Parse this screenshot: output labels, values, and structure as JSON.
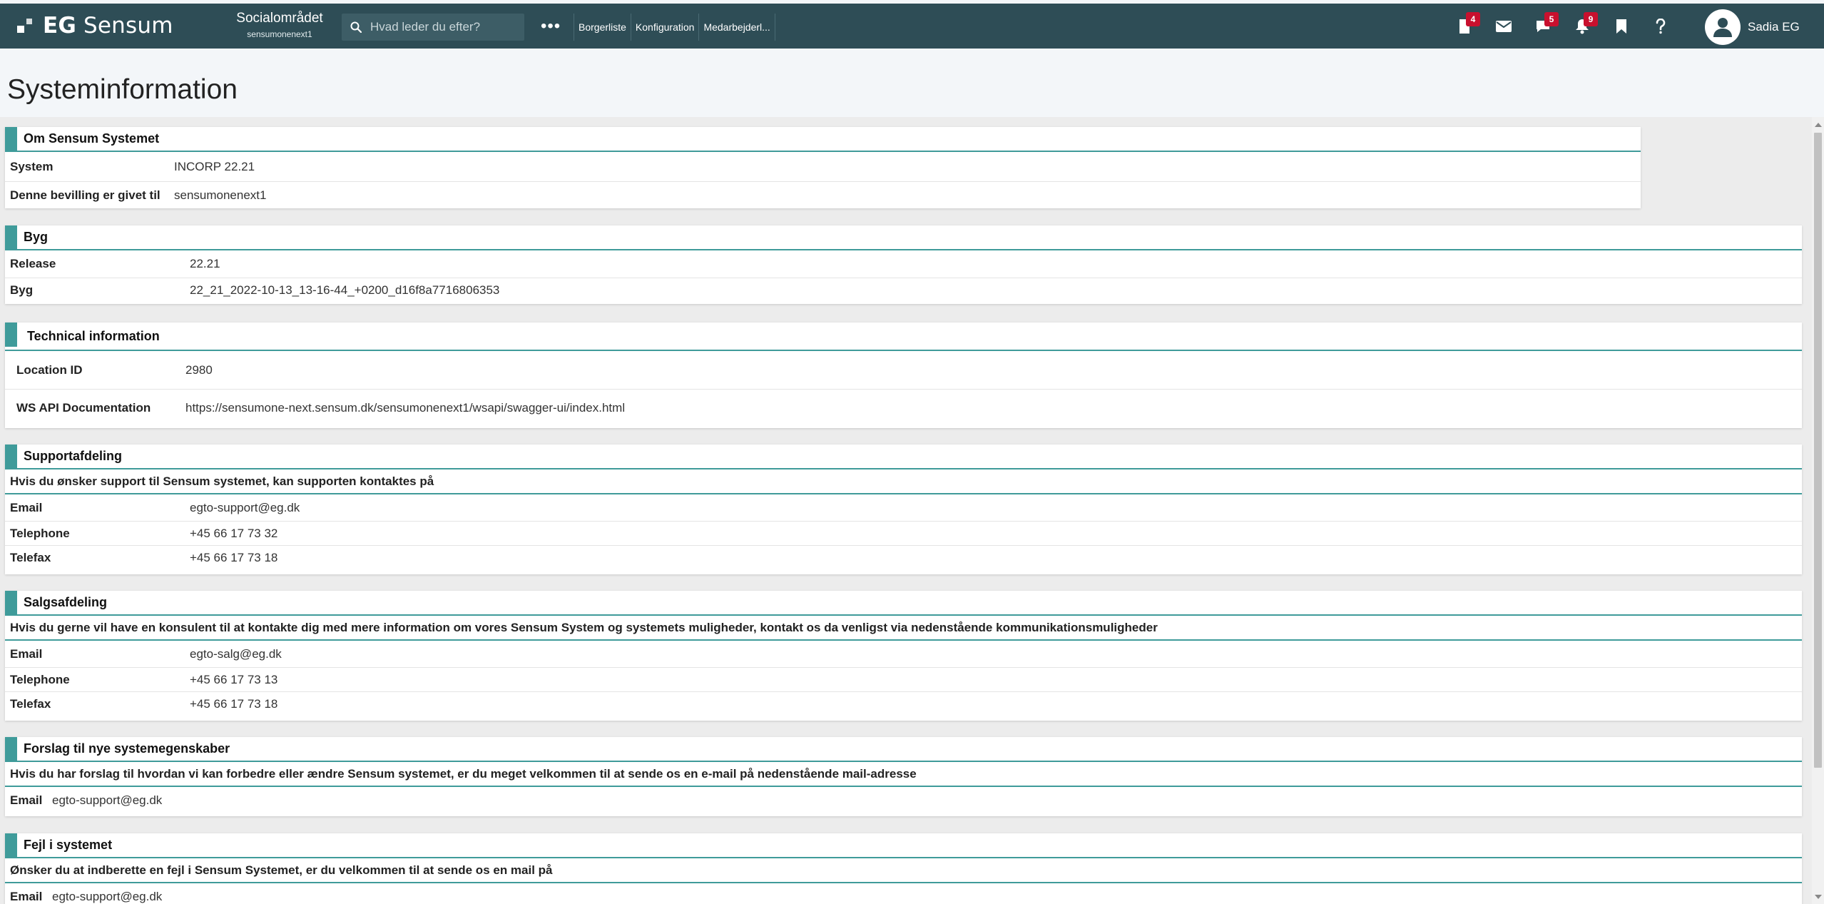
{
  "header": {
    "brand_bold": "EG",
    "brand_name": "Sensum",
    "area_title": "Socialområdet",
    "area_sub": "sensumonenext1",
    "search_placeholder": "Hvad leder du efter?",
    "more_label": "•••",
    "nav": [
      "Borgerliste",
      "Konfiguration",
      "Medarbejderl..."
    ],
    "badges": {
      "tasks": "4",
      "messages": "5",
      "notifications": "9"
    },
    "user_name": "Sadia EG"
  },
  "page": {
    "title": "Systeminformation"
  },
  "sections": {
    "about": {
      "title": "Om Sensum Systemet",
      "rows": [
        {
          "label": "System",
          "value": "INCORP 22.21"
        },
        {
          "label": "Denne bevilling er givet til",
          "value": "sensumonenext1"
        }
      ]
    },
    "build": {
      "title": "Byg",
      "rows": [
        {
          "label": "Release",
          "value": "22.21"
        },
        {
          "label": "Byg",
          "value": "22_21_2022-10-13_13-16-44_+0200_d16f8a7716806353"
        }
      ]
    },
    "tech": {
      "title": "Technical information",
      "rows": [
        {
          "label": "Location ID",
          "value": "2980"
        },
        {
          "label": "WS API Documentation",
          "value": "https://sensumone-next.sensum.dk/sensumonenext1/wsapi/swagger-ui/index.html"
        }
      ]
    },
    "support": {
      "title": "Supportafdeling",
      "intro": "Hvis du ønsker support til Sensum systemet, kan supporten kontaktes på",
      "rows": [
        {
          "label": "Email",
          "value": "egto-support@eg.dk"
        },
        {
          "label": "Telephone",
          "value": "+45 66 17 73 32"
        },
        {
          "label": "Telefax",
          "value": "+45 66 17 73 18"
        }
      ]
    },
    "sales": {
      "title": "Salgsafdeling",
      "intro": "Hvis du gerne vil have en konsulent til at kontakte dig med mere information om vores Sensum System og systemets muligheder, kontakt os da venligst via nedenstående kommunikationsmuligheder",
      "rows": [
        {
          "label": "Email",
          "value": "egto-salg@eg.dk"
        },
        {
          "label": "Telephone",
          "value": "+45 66 17 73 13"
        },
        {
          "label": "Telefax",
          "value": "+45 66 17 73 18"
        }
      ]
    },
    "suggest": {
      "title": "Forslag til nye systemegenskaber",
      "intro": "Hvis du har forslag til hvordan vi kan forbedre eller ændre Sensum systemet, er du meget velkommen til at sende os en e-mail på nedenstående mail-adresse",
      "rows": [
        {
          "label": "Email",
          "value": "egto-support@eg.dk"
        }
      ]
    },
    "errors": {
      "title": "Fejl i systemet",
      "intro": "Ønsker du at indberette en fejl i Sensum Systemet, er du velkommen til at sende os en mail på",
      "rows": [
        {
          "label": "Email",
          "value": "egto-support@eg.dk"
        }
      ]
    }
  },
  "colors": {
    "topbar": "#2e4d56",
    "accent": "#3f9b9a",
    "badge": "#c8102e"
  }
}
